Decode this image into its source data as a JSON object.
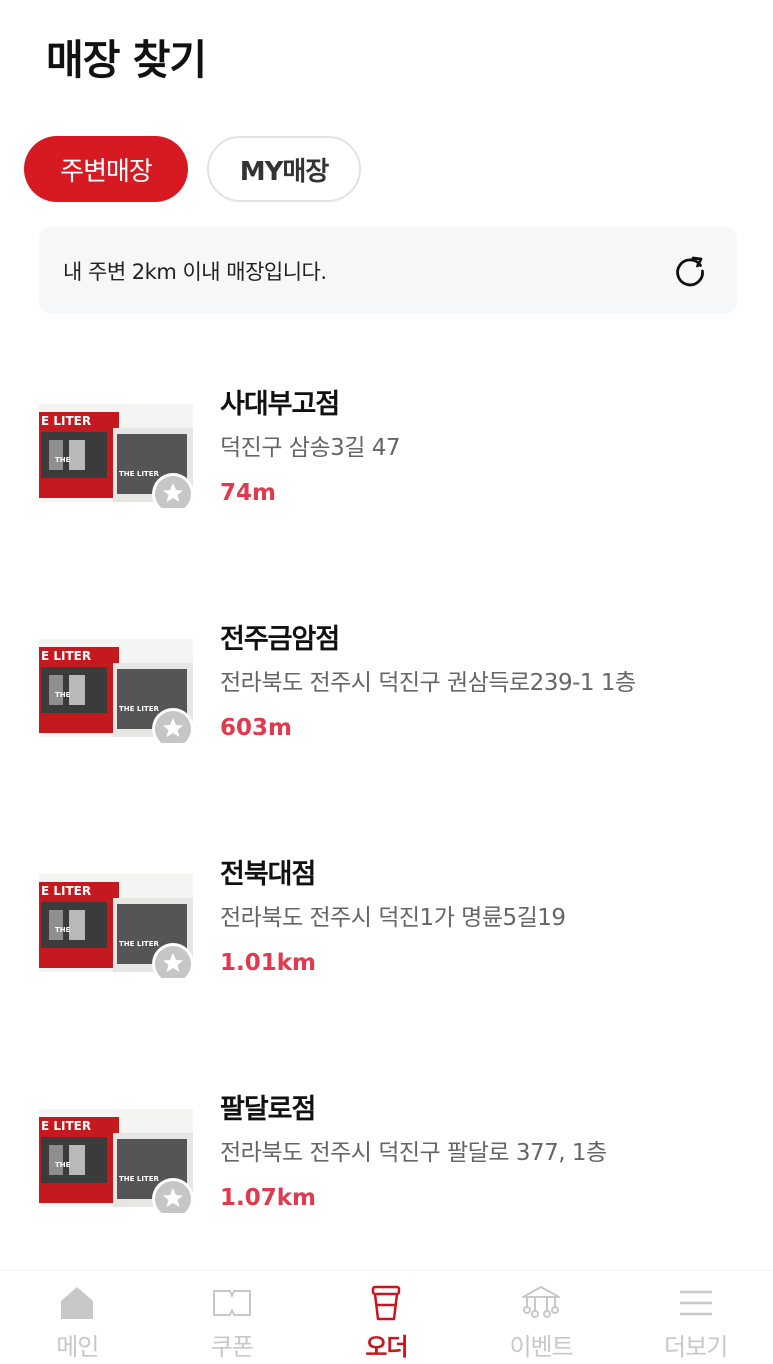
{
  "header": {
    "title": "매장 찾기"
  },
  "tabs": [
    {
      "label": "주변매장",
      "active": true
    },
    {
      "label": "MY매장",
      "active": false
    }
  ],
  "notice": {
    "text": "내 주변 2km 이내 매장입니다.",
    "icon": "refresh-icon"
  },
  "stores": [
    {
      "name": "사대부고점",
      "address": "덕진구 삼송3길 47",
      "distance": "74m",
      "thumb_text": "E LITER"
    },
    {
      "name": "전주금암점",
      "address": "전라북도 전주시 덕진구 권삼득로239-1 1층",
      "distance": "603m",
      "thumb_text": "E LITER"
    },
    {
      "name": "전북대점",
      "address": "전라북도 전주시 덕진1가 명륜5길19",
      "distance": "1.01km",
      "thumb_text": "E LITER"
    },
    {
      "name": "팔달로점",
      "address": "전라북도 전주시 덕진구 팔달로 377, 1층",
      "distance": "1.07km",
      "thumb_text": "E LITER"
    }
  ],
  "bottom_nav": [
    {
      "label": "메인",
      "icon": "home-icon",
      "active": false
    },
    {
      "label": "쿠폰",
      "icon": "coupon-icon",
      "active": false
    },
    {
      "label": "오더",
      "icon": "cup-icon",
      "active": true
    },
    {
      "label": "이벤트",
      "icon": "event-icon",
      "active": false
    },
    {
      "label": "더보기",
      "icon": "menu-icon",
      "active": false
    }
  ],
  "colors": {
    "brand": "#d71921",
    "distance": "#e03a4e",
    "inactive": "#c8c8c8"
  }
}
